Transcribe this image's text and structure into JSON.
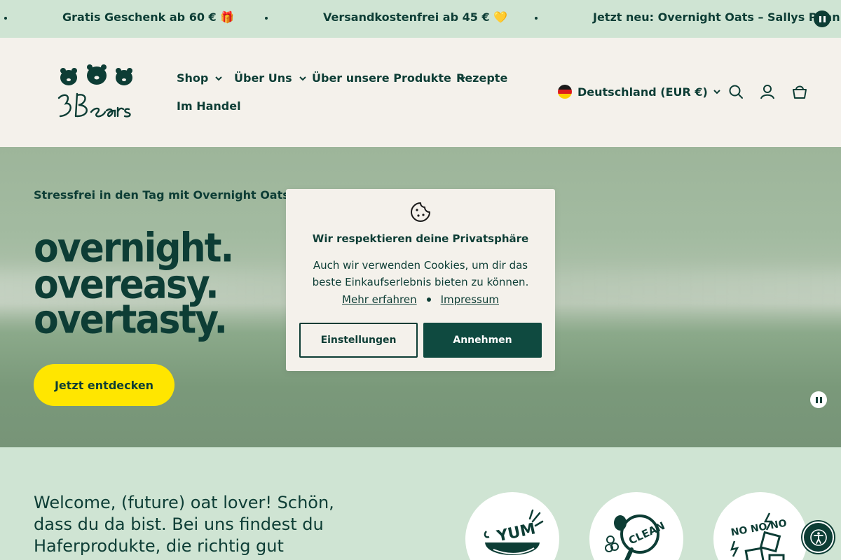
{
  "announcement": {
    "messages": [
      "Gratis Geschenk ab 60 € 🎁",
      "Versandkostenfrei ab 45 € 💛",
      "Jetzt neu: Overnight Oats – Sallys Pean"
    ]
  },
  "header": {
    "logo_text": "3Bears",
    "nav": {
      "shop": "Shop",
      "about": "Über Uns",
      "products": "Über unsere Produkte",
      "recipes": "Rezepte",
      "retail": "Im Handel"
    },
    "country": "Deutschland (EUR €)",
    "icons": [
      "search-icon",
      "account-icon",
      "cart-icon"
    ]
  },
  "hero": {
    "subtitle": "Stressfrei in den Tag mit Overnight Oats.",
    "lines": [
      "overnight.",
      "overeasy.",
      "overtasty."
    ],
    "cta": "Jetzt entdecken"
  },
  "cookie": {
    "title": "Wir respektieren deine Privatsphäre",
    "text": "Auch wir verwenden Cookies, um dir das beste Einkaufserlebnis bieten zu können.",
    "link_more": "Mehr erfahren",
    "link_imprint": "Impressum",
    "settings": "Einstellungen",
    "accept": "Annehmen"
  },
  "welcome": {
    "text": "Welcome, (future) oat lover! Schön, dass du da bist. Bei uns findest du Haferprodukte, die richtig gut",
    "badges": [
      "YUM",
      "CLEAN",
      "NO NO NO"
    ]
  },
  "colors": {
    "primary": "#0d3d35",
    "mint": "#cfe4d3",
    "cream": "#f4f1eb",
    "yellow": "#ffe600"
  }
}
